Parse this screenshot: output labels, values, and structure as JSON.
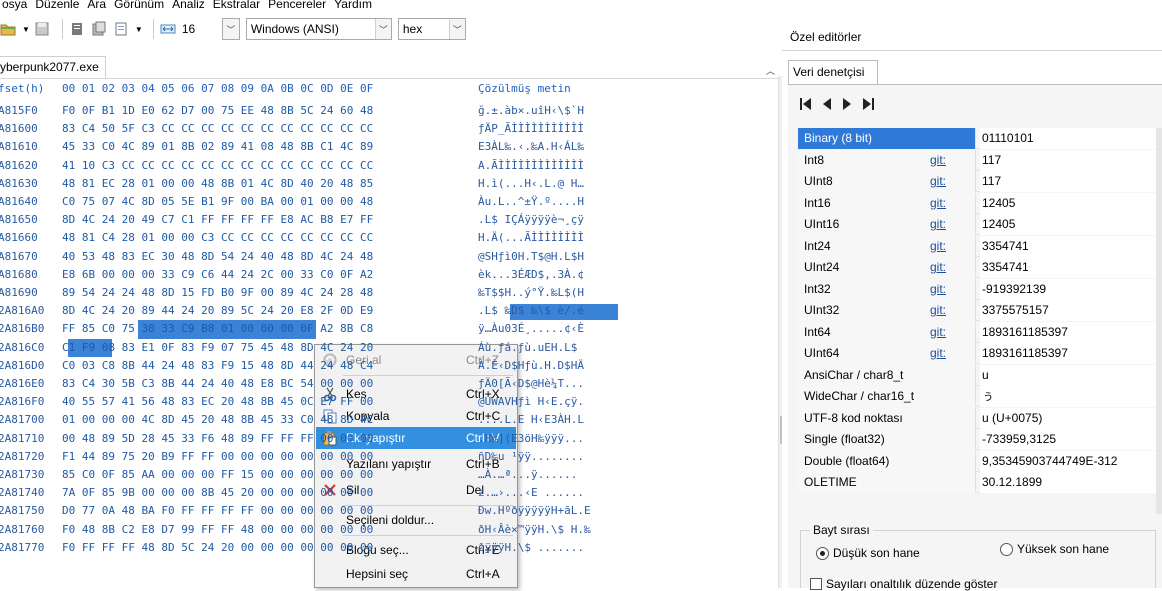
{
  "menu": [
    "osya",
    "Düzenle",
    "Ara",
    "Görünüm",
    "Analiz",
    "Ekstralar",
    "Pencereler",
    "Yardım"
  ],
  "toolbar": {
    "bytes_per_row": "16",
    "encoding": "Windows (ANSI)",
    "mode": "hex"
  },
  "file_tab": "yberpunk2077.exe",
  "hex_header": {
    "offset": "fset(h)",
    "bytes": "00 01 02 03 04 05 06 07 08 09 0A 0B 0C 0D 0E 0F",
    "text": "Çözülmüş metin"
  },
  "hex_rows": [
    {
      "offset": "A815F0",
      "bytes": "F0 0F B1 1D E0 62 D7 00 75 EE 48 8B 5C 24 60 48",
      "text": "ğ.±.àb×.uîH‹\\$`H"
    },
    {
      "offset": "A81600",
      "bytes": "83 C4 50 5F C3 CC CC CC CC CC CC CC CC CC CC CC",
      "text": "ƒÄP_ÃÌÌÌÌÌÌÌÌÌÌÌ"
    },
    {
      "offset": "A81610",
      "bytes": "45 33 C0 4C 89 01 8B 02 89 41 08 48 8B C1 4C 89",
      "text": "E3ÀL‰.‹.‰A.H‹ÁL‰"
    },
    {
      "offset": "A81620",
      "bytes": "41 10 C3 CC CC CC CC CC CC CC CC CC CC CC CC CC",
      "text": "A.ÃÌÌÌÌÌÌÌÌÌÌÌÌÌ"
    },
    {
      "offset": "A81630",
      "bytes": "48 81 EC 28 01 00 00 48 8B 01 4C 8D 40 20 48 85",
      "text": "H.ì(...H‹.L.@ H…"
    },
    {
      "offset": "A81640",
      "bytes": "C0 75 07 4C 8D 05 5E B1 9F 00 BA 00 01 00 00 48",
      "text": "Àu.L..^±Ÿ.º....H"
    },
    {
      "offset": "A81650",
      "bytes": "8D 4C 24 20 49 C7 C1 FF FF FF FF E8 AC B8 E7 FF",
      "text": ".L$ IÇÁÿÿÿÿè¬¸çÿ"
    },
    {
      "offset": "A81660",
      "bytes": "48 81 C4 28 01 00 00 C3 CC CC CC CC CC CC CC CC",
      "text": "H.Ä(...ÃÌÌÌÌÌÌÌÌ"
    },
    {
      "offset": "A81670",
      "bytes": "40 53 48 83 EC 30 48 8D 54 24 40 48 8D 4C 24 48",
      "text": "@SHƒì0H.T$@H.L$H"
    },
    {
      "offset": "A81680",
      "bytes": "E8 6B 00 00 00 33 C9 C6 44 24 2C 00 33 C0 0F A2",
      "text": "èk...3ÉÆD$,.3À.¢"
    },
    {
      "offset": "A81690",
      "bytes": "89 54 24 24 48 8D 15 FD B0 9F 00 89 4C 24 28 48",
      "text": "‰T$$H..ý°Ÿ.‰L$(H"
    },
    {
      "offset": "2A816A0",
      "bytes": "8D 4C 24 20 89 44 24 20 89 5C 24 20 E8 2F 0D E9",
      "text": ".L$ ‰D$ ‰\\$ è/.é"
    },
    {
      "offset": "2A816B0",
      "bytes": "FF 85 C0 75 30 33 C9 B8 01 00 00 00 0F A2 8B C8",
      "text": "ÿ…Àu03É¸.....¢‹È"
    },
    {
      "offset": "2A816C0",
      "bytes": "C1 F9 08 83 E1 0F 83 F9 07 75 45 48 8D 4C 24 20",
      "text": "Áù.ƒá.ƒù.uEH.L$ "
    },
    {
      "offset": "2A816D0",
      "bytes": "C0 03 C8 8B 44 24 48 83 F9 15 48 8D 44 24 48 C4",
      "text": "À.È‹D$Hƒù.H.D$HÄ"
    },
    {
      "offset": "2A816E0",
      "bytes": "83 C4 30 5B C3 8B 44 24 40 48 E8 BC 54 00 00 00",
      "text": "ƒÄ0[Ã‹D$@Hè¼T..."
    },
    {
      "offset": "2A816F0",
      "bytes": "40 55 57 41 56 48 83 EC 20 48 8B 45 0C E7 FF 00",
      "text": "@UWAVHƒì H‹E.çÿ."
    },
    {
      "offset": "2A81700",
      "bytes": "01 00 00 00 4C 8D 45 20 48 8B 45 33 C0 48 8D 4C",
      "text": "....L.E H‹E3ÀH.L"
    },
    {
      "offset": "2A81710",
      "bytes": "00 48 89 5D 28 45 33 F6 48 89 FF FF FF 00 00 00",
      "text": ".H‰](E3öH‰ÿÿÿ..."
    },
    {
      "offset": "2A81720",
      "bytes": "F1 44 89 75 20 B9 FF FF 00 00 00 00 00 00 00 00",
      "text": "ñD‰u ¹ÿÿ........"
    },
    {
      "offset": "2A81730",
      "bytes": "85 C0 0F 85 AA 00 00 00 FF 15 00 00 00 00 00 00",
      "text": "…À.…ª...ÿ......"
    },
    {
      "offset": "2A81740",
      "bytes": "7A 0F 85 9B 00 00 00 8B 45 20 00 00 00 00 00 00",
      "text": "z.…›...‹E ......"
    },
    {
      "offset": "2A81750",
      "bytes": "D0 77 0A 48 BA F0 FF FF FF FF 00 00 00 00 00 00",
      "text": "Ðw.HºðÿÿÿÿÿH+ãL.E"
    },
    {
      "offset": "2A81760",
      "bytes": "F0 48 8B C2 E8 D7 99 FF FF 48 00 00 00 00 00 00",
      "text": "ðH‹Âè×™ÿÿH.\\$ H.‰"
    },
    {
      "offset": "2A81770",
      "bytes": "F0 FF FF FF 48 8D 5C 24 20 00 00 00 00 00 00 00",
      "text": "ðÿÿÿH.\\$ ......."
    }
  ],
  "context_menu": {
    "undo": {
      "label": "Geri al",
      "shortcut": "Ctrl+Z"
    },
    "cut": {
      "label": "Kes",
      "shortcut": "Ctrl+X"
    },
    "copy": {
      "label": "Kopyala",
      "shortcut": "Ctrl+C"
    },
    "paste_insert": {
      "label": "Eki yapıştır",
      "shortcut": "Ctrl+V"
    },
    "paste_write": {
      "label": "Yazılanı yapıştır",
      "shortcut": "Ctrl+B"
    },
    "delete": {
      "label": "Sil",
      "shortcut": "Del"
    },
    "fill": {
      "label": "Seçileni doldur..."
    },
    "select_block": {
      "label": "Bloğu seç...",
      "shortcut": "Ctrl+E"
    },
    "select_all": {
      "label": "Hepsini seç",
      "shortcut": "Ctrl+A"
    }
  },
  "right_panel": {
    "title": "Özel editörler",
    "tab": "Veri denetçisi",
    "goto_label": "git:",
    "rows": [
      {
        "name": "Binary (8 bit)",
        "value": "01110101",
        "git": false,
        "selected": true
      },
      {
        "name": "Int8",
        "value": "117",
        "git": true
      },
      {
        "name": "UInt8",
        "value": "117",
        "git": true
      },
      {
        "name": "Int16",
        "value": "12405",
        "git": true
      },
      {
        "name": "UInt16",
        "value": "12405",
        "git": true
      },
      {
        "name": "Int24",
        "value": "3354741",
        "git": true
      },
      {
        "name": "UInt24",
        "value": "3354741",
        "git": true
      },
      {
        "name": "Int32",
        "value": "-919392139",
        "git": true
      },
      {
        "name": "UInt32",
        "value": "3375575157",
        "git": true
      },
      {
        "name": "Int64",
        "value": "1893161185397",
        "git": true
      },
      {
        "name": "UInt64",
        "value": "1893161185397",
        "git": true
      },
      {
        "name": "AnsiChar / char8_t",
        "value": "u",
        "git": false
      },
      {
        "name": "WideChar / char16_t",
        "value": "ぅ",
        "git": false
      },
      {
        "name": "UTF-8 kod noktası",
        "value": "u (U+0075)",
        "git": false
      },
      {
        "name": "Single (float32)",
        "value": "-733959,3125",
        "git": false
      },
      {
        "name": "Double (float64)",
        "value": "9,35345903744749E-312",
        "git": false
      },
      {
        "name": "OLETIME",
        "value": "30.12.1899",
        "git": false
      }
    ],
    "byte_order": {
      "title": "Bayt sırası",
      "little": "Düşük son hane",
      "big": "Yüksek son hane"
    },
    "hex_checkbox": "Sayıları onaltılık düzende göster"
  }
}
